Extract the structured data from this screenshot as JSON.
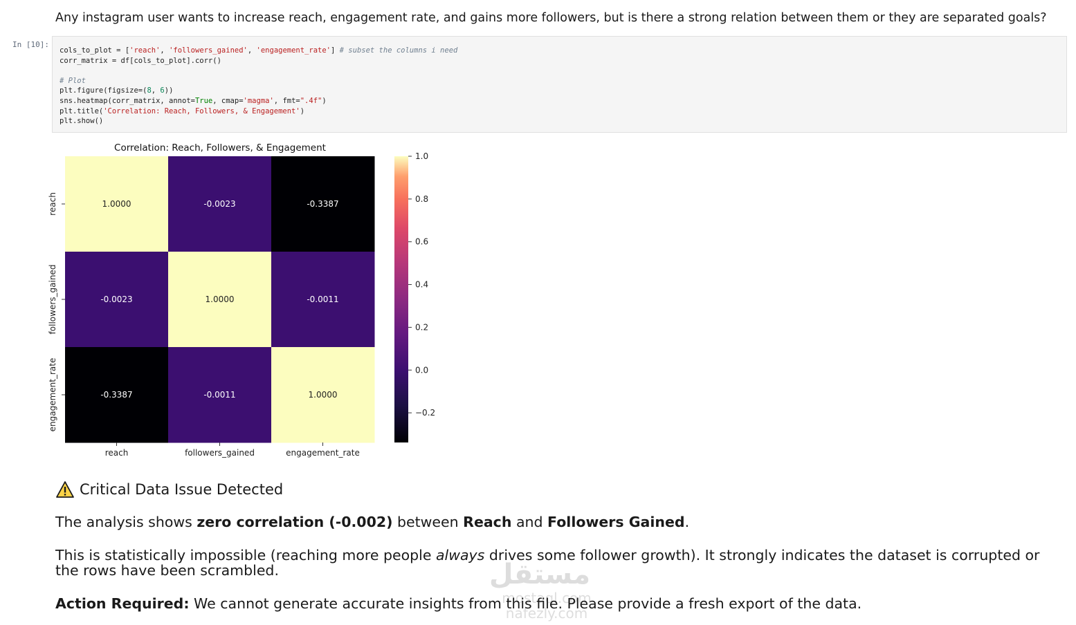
{
  "question": "Any instagram user wants to increase reach, engagement rate, and gains more followers, but is there a strong relation between them or they are separated goals?",
  "cell": {
    "prompt": "In [10]:",
    "code_lines": [
      [
        {
          "t": "cols_to_plot = ["
        },
        {
          "t": "'reach'",
          "c": "str"
        },
        {
          "t": ", "
        },
        {
          "t": "'followers_gained'",
          "c": "str"
        },
        {
          "t": ", "
        },
        {
          "t": "'engagement_rate'",
          "c": "str"
        },
        {
          "t": "] "
        },
        {
          "t": "# subset the columns i need",
          "c": "com"
        }
      ],
      [
        {
          "t": "corr_matrix = df[cols_to_plot].corr()"
        }
      ],
      [
        {
          "t": ""
        }
      ],
      [
        {
          "t": "# Plot",
          "c": "com"
        }
      ],
      [
        {
          "t": "plt.figure(figsize=("
        },
        {
          "t": "8",
          "c": "num"
        },
        {
          "t": ", "
        },
        {
          "t": "6",
          "c": "num"
        },
        {
          "t": "))"
        }
      ],
      [
        {
          "t": "sns.heatmap(corr_matrix, annot="
        },
        {
          "t": "True",
          "c": "kw"
        },
        {
          "t": ", cmap="
        },
        {
          "t": "'magma'",
          "c": "str"
        },
        {
          "t": ", fmt="
        },
        {
          "t": "\".4f\"",
          "c": "str"
        },
        {
          "t": ")"
        }
      ],
      [
        {
          "t": "plt.title("
        },
        {
          "t": "'Correlation: Reach, Followers, & Engagement'",
          "c": "str"
        },
        {
          "t": ")"
        }
      ],
      [
        {
          "t": "plt.show()"
        }
      ]
    ]
  },
  "chart_data": {
    "type": "heatmap",
    "title": "Correlation: Reach, Followers, & Engagement",
    "rows": [
      "reach",
      "followers_gained",
      "engagement_rate"
    ],
    "columns": [
      "reach",
      "followers_gained",
      "engagement_rate"
    ],
    "values": [
      [
        1.0,
        -0.0023,
        -0.3387
      ],
      [
        -0.0023,
        1.0,
        -0.0011
      ],
      [
        -0.3387,
        -0.0011,
        1.0
      ]
    ],
    "annotations": [
      [
        "1.0000",
        "-0.0023",
        "-0.3387"
      ],
      [
        "-0.0023",
        "1.0000",
        "-0.0011"
      ],
      [
        "-0.3387",
        "-0.0011",
        "1.0000"
      ]
    ],
    "colormap": "magma",
    "vmin": -0.3387,
    "vmax": 1.0,
    "colorbar_ticks": [
      1.0,
      0.8,
      0.6,
      0.4,
      0.2,
      0.0,
      -0.2
    ],
    "colorbar_tick_labels": [
      "1.0",
      "0.8",
      "0.6",
      "0.4",
      "0.2",
      "0.0",
      "−0.2"
    ]
  },
  "output": {
    "warning_icon": "warning-triangle-icon",
    "warning_title": "Critical Data Issue Detected",
    "p1": {
      "a": "The analysis shows ",
      "b": "zero correlation (-0.002)",
      "c": " between ",
      "d": "Reach",
      "e": " and ",
      "f": "Followers Gained",
      "g": "."
    },
    "p2": {
      "a": "This is statistically impossible (reaching more people ",
      "b": "always",
      "c": " drives some follower growth). It strongly indicates the dataset is corrupted or the rows have been scrambled."
    },
    "p3": {
      "a": "Action Required:",
      "b": " We cannot generate accurate insights from this file. Please provide a fresh export of the data."
    }
  },
  "watermark": {
    "logo_text": "مستقل",
    "site_text": "mostaql.com",
    "site_text_2": "nafezly.com"
  }
}
